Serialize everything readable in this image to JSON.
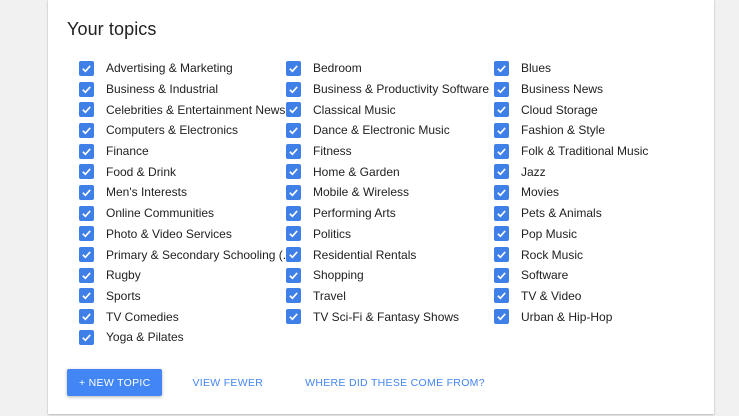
{
  "section": {
    "title": "Your topics"
  },
  "topics": {
    "col1": [
      "Advertising & Marketing",
      "Business & Industrial",
      "Celebrities & Entertainment News",
      "Computers & Electronics",
      "Finance",
      "Food & Drink",
      "Men's Interests",
      "Online Communities",
      "Photo & Video Services",
      "Primary & Secondary Schooling (...",
      "Rugby",
      "Sports",
      "TV Comedies",
      "Yoga & Pilates"
    ],
    "col2": [
      "Bedroom",
      "Business & Productivity Software",
      "Classical Music",
      "Dance & Electronic Music",
      "Fitness",
      "Home & Garden",
      "Mobile & Wireless",
      "Performing Arts",
      "Politics",
      "Residential Rentals",
      "Shopping",
      "Travel",
      "TV Sci-Fi & Fantasy Shows"
    ],
    "col3": [
      "Blues",
      "Business News",
      "Cloud Storage",
      "Fashion & Style",
      "Folk & Traditional Music",
      "Jazz",
      "Movies",
      "Pets & Animals",
      "Pop Music",
      "Rock Music",
      "Software",
      "TV & Video",
      "Urban & Hip-Hop"
    ],
    "checked": true
  },
  "actions": {
    "new_topic": "+ NEW TOPIC",
    "view_fewer": "VIEW FEWER",
    "where_from": "WHERE DID THESE COME FROM?"
  },
  "colors": {
    "checkbox": "#3f7fe8",
    "accent": "#4285f4",
    "text": "#212121"
  },
  "icons": {
    "checkbox": "checkmark-icon"
  }
}
